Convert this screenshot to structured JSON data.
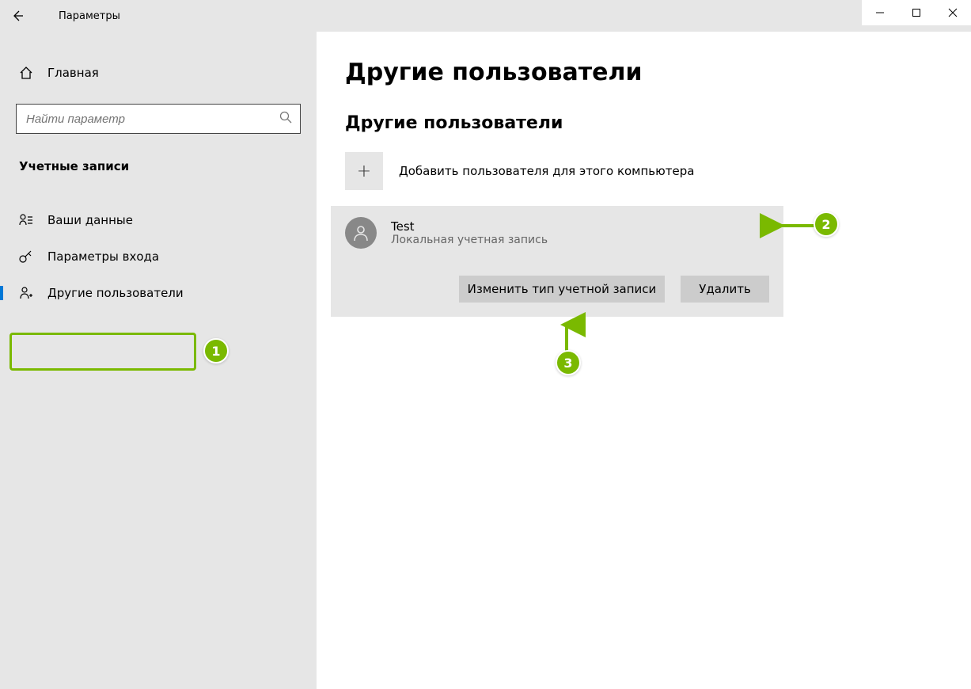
{
  "window": {
    "title": "Параметры"
  },
  "sidebar": {
    "home_label": "Главная",
    "search_placeholder": "Найти параметр",
    "section_title": "Учетные записи",
    "items": [
      {
        "label": "Ваши данные"
      },
      {
        "label": "Параметры входа"
      },
      {
        "label": "Другие пользователи"
      }
    ]
  },
  "content": {
    "page_title": "Другие пользователи",
    "section_title": "Другие пользователи",
    "add_user_label": "Добавить пользователя для этого компьютера",
    "user": {
      "name": "Test",
      "type": "Локальная учетная запись"
    },
    "buttons": {
      "change_type": "Изменить тип учетной записи",
      "delete": "Удалить"
    }
  },
  "annotations": {
    "badge1": "1",
    "badge2": "2",
    "badge3": "3"
  },
  "colors": {
    "accent": "#0078d7",
    "annotation": "#7ab900",
    "sidebar_bg": "#e6e6e6",
    "button_bg": "#cccccc"
  }
}
